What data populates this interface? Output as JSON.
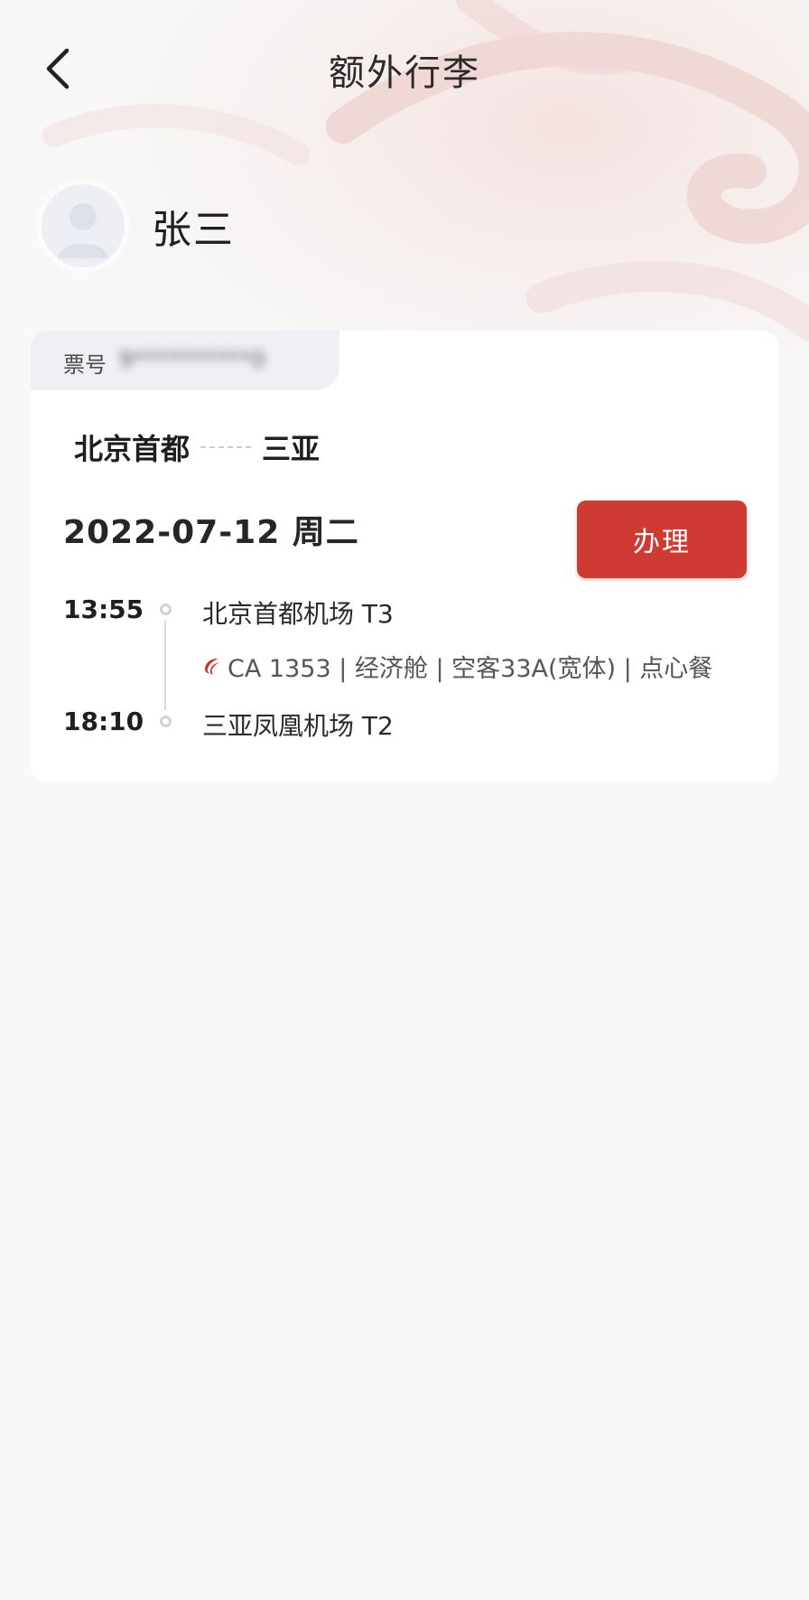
{
  "header": {
    "title": "额外行李"
  },
  "passenger": {
    "name": "张三"
  },
  "ticket": {
    "label": "票号",
    "number": "9**********0"
  },
  "route": {
    "from": "北京首都",
    "to": "三亚"
  },
  "date": "2022-07-12 周二",
  "action": {
    "label": "办理"
  },
  "departure": {
    "time": "13:55",
    "airport": "北京首都机场 T3"
  },
  "flight_info": "CA 1353 | 经济舱 | 空客33A(宽体) | 点心餐",
  "arrival": {
    "time": "18:10",
    "airport": "三亚凤凰机场 T2"
  },
  "colors": {
    "accent": "#cf3a32",
    "background": "#f8f8f8",
    "card": "#ffffff"
  },
  "icons": {
    "back": "chevron-left-icon",
    "avatar": "person-avatar-icon",
    "airline_logo": "air-china-logo-icon"
  }
}
